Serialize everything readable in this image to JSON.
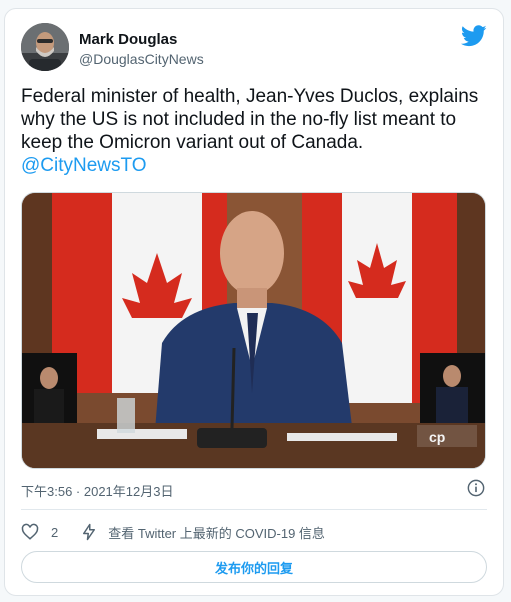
{
  "author": {
    "name": "Mark Douglas",
    "handle": "@DouglasCityNews"
  },
  "tweet": {
    "text": "Federal minister of health, Jean-Yves Duclos, explains why the US is not included in the no-fly list meant to keep the Omicron variant out of Canada.",
    "mention": "@CityNewsTO"
  },
  "media": {
    "watermark": "cp"
  },
  "meta": {
    "timestamp": "下午3:56 · 2021年12月3日"
  },
  "actions": {
    "like_count": "2",
    "covid_label": "查看 Twitter 上最新的 COVID-19 信息",
    "reply_label": "发布你的回复"
  },
  "icons": {
    "brand": "twitter-bird-icon",
    "info": "info-icon",
    "like": "heart-icon",
    "covid": "lightning-icon"
  },
  "colors": {
    "accent": "#1d9bf0",
    "text": "#0f1419",
    "muted": "#536471",
    "flag_red": "#d52b1e"
  }
}
